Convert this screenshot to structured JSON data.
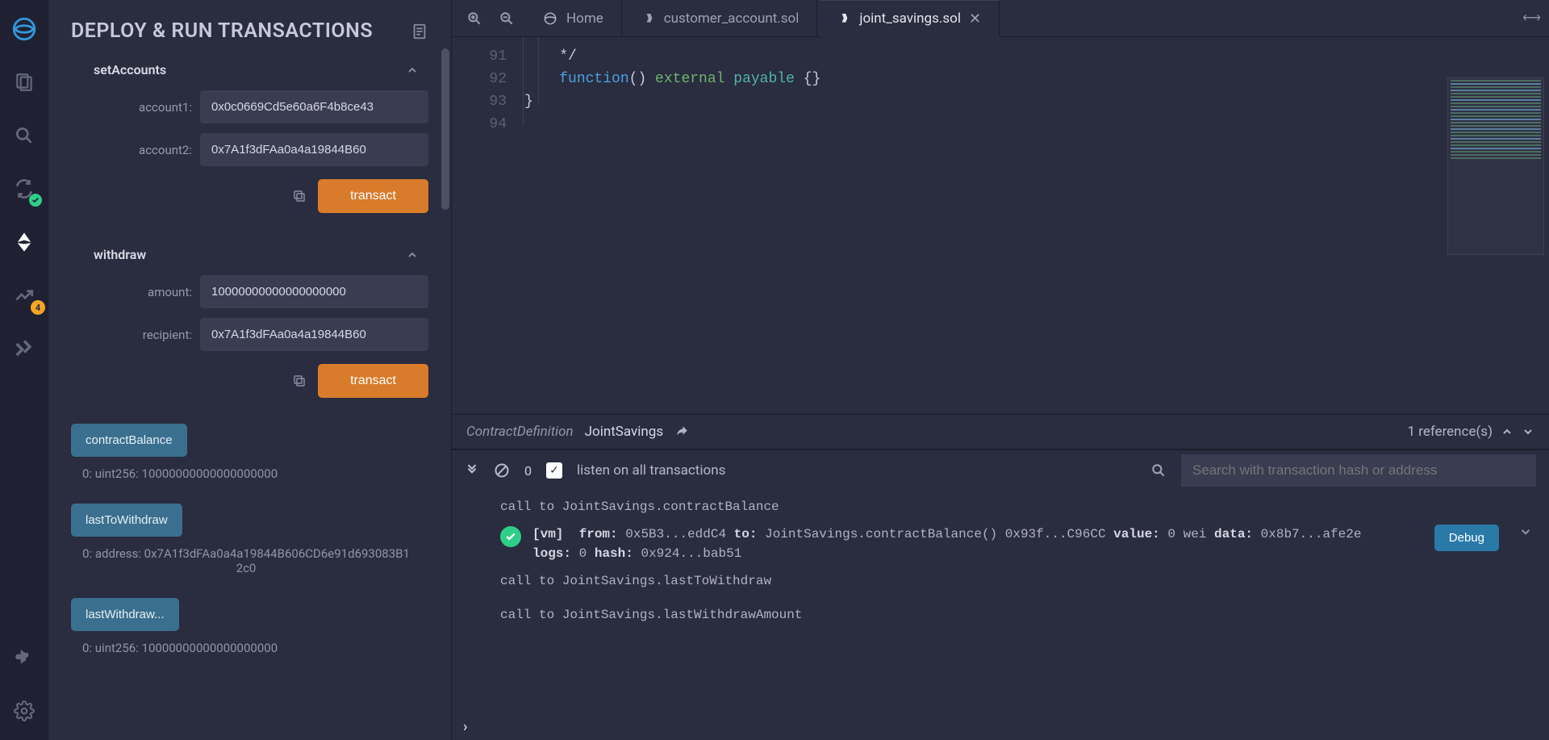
{
  "panel": {
    "title": "DEPLOY & RUN TRANSACTIONS",
    "functions": [
      {
        "name": "setAccounts",
        "params": [
          {
            "label": "account1:",
            "value": "0x0c0669Cd5e60a6F4b8ce43"
          },
          {
            "label": "account2:",
            "value": "0x7A1f3dFAa0a4a19844B60"
          }
        ],
        "action": "transact"
      },
      {
        "name": "withdraw",
        "params": [
          {
            "label": "amount:",
            "value": "10000000000000000000"
          },
          {
            "label": "recipient:",
            "value": "0x7A1f3dFAa0a4a19844B60"
          }
        ],
        "action": "transact"
      }
    ],
    "views": [
      {
        "label": "contractBalance",
        "result": "0: uint256: 10000000000000000000"
      },
      {
        "label": "lastToWithdraw",
        "result": "0: address: 0x7A1f3dFAa0a4a19844B606CD6e91d693083B12c0"
      },
      {
        "label": "lastWithdraw...",
        "result": "0: uint256: 10000000000000000000"
      }
    ]
  },
  "tabs": {
    "home": "Home",
    "items": [
      {
        "label": "customer_account.sol",
        "active": false
      },
      {
        "label": "joint_savings.sol",
        "active": true
      }
    ]
  },
  "editor": {
    "lines": [
      {
        "num": "91",
        "html": "        */"
      },
      {
        "num": "92",
        "html": "        function() external payable {}"
      },
      {
        "num": "93",
        "html": "    }"
      },
      {
        "num": "94",
        "html": ""
      }
    ]
  },
  "breadcrumb": {
    "kind": "ContractDefinition",
    "name": "JointSavings",
    "refs": "1 reference(s)"
  },
  "terminal": {
    "count": "0",
    "listen_label": "listen on all transactions",
    "search_placeholder": "Search with transaction hash or address",
    "lines_before": [
      "call to JointSavings.contractBalance"
    ],
    "tx": {
      "vm": "[vm]",
      "from_lbl": "from:",
      "from": "0x5B3...eddC4",
      "to_lbl": "to:",
      "to": "JointSavings.contractBalance() 0x93f...C96CC",
      "value_lbl": "value:",
      "value": "0 wei",
      "data_lbl": "data:",
      "data": "0x8b7...afe2e",
      "logs_lbl": "logs:",
      "logs": "0",
      "hash_lbl": "hash:",
      "hash": "0x924...bab51",
      "debug": "Debug"
    },
    "lines_after": [
      "call to JointSavings.lastToWithdraw",
      "call to JointSavings.lastWithdrawAmount"
    ]
  },
  "badges": {
    "analysis": "4"
  }
}
